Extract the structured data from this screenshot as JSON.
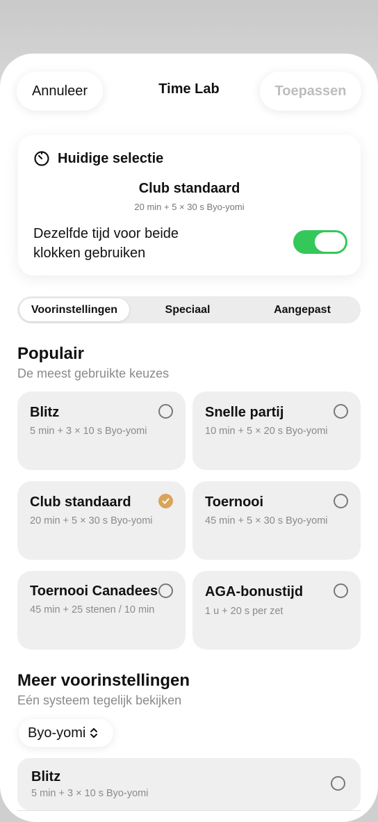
{
  "header": {
    "cancel_label": "Annuleer",
    "title": "Time Lab",
    "apply_label": "Toepassen"
  },
  "current_selection": {
    "heading": "Huidige selectie",
    "name": "Club standaard",
    "detail": "20 min + 5 × 30 s Byo-yomi",
    "same_time_label": "Dezelfde tijd voor beide klokken gebruiken",
    "same_time_enabled": true
  },
  "tabs": [
    {
      "label": "Voorinstellingen",
      "active": true
    },
    {
      "label": "Speciaal",
      "active": false
    },
    {
      "label": "Aangepast",
      "active": false
    }
  ],
  "popular": {
    "title": "Populair",
    "subtitle": "De meest gebruikte keuzes",
    "presets": [
      {
        "name": "Blitz",
        "detail": "5 min + 3 × 10 s Byo-yomi",
        "selected": false
      },
      {
        "name": "Snelle partij",
        "detail": "10 min + 5 × 20 s Byo-yomi",
        "selected": false
      },
      {
        "name": "Club standaard",
        "detail": "20 min + 5 × 30 s Byo-yomi",
        "selected": true
      },
      {
        "name": "Toernooi",
        "detail": "45 min + 5 × 30 s Byo-yomi",
        "selected": false
      },
      {
        "name": "Toernooi Canadees",
        "detail": "45 min + 25 stenen / 10 min",
        "selected": false
      },
      {
        "name": "AGA-bonustijd",
        "detail": "1 u + 20 s per zet",
        "selected": false
      }
    ]
  },
  "more": {
    "title": "Meer voorinstellingen",
    "subtitle": "Eén systeem tegelijk bekijken",
    "system_selected": "Byo-yomi",
    "items": [
      {
        "name": "Blitz",
        "detail": "5 min + 3 × 10 s Byo-yomi",
        "selected": false
      }
    ]
  },
  "colors": {
    "toggle_on": "#34c759",
    "selected_accent": "#d9a45b",
    "card_bg": "#efefef"
  },
  "icons": {
    "timer": "timer-icon",
    "check": "checkmark-icon",
    "updown": "chevron-up-down-icon"
  }
}
